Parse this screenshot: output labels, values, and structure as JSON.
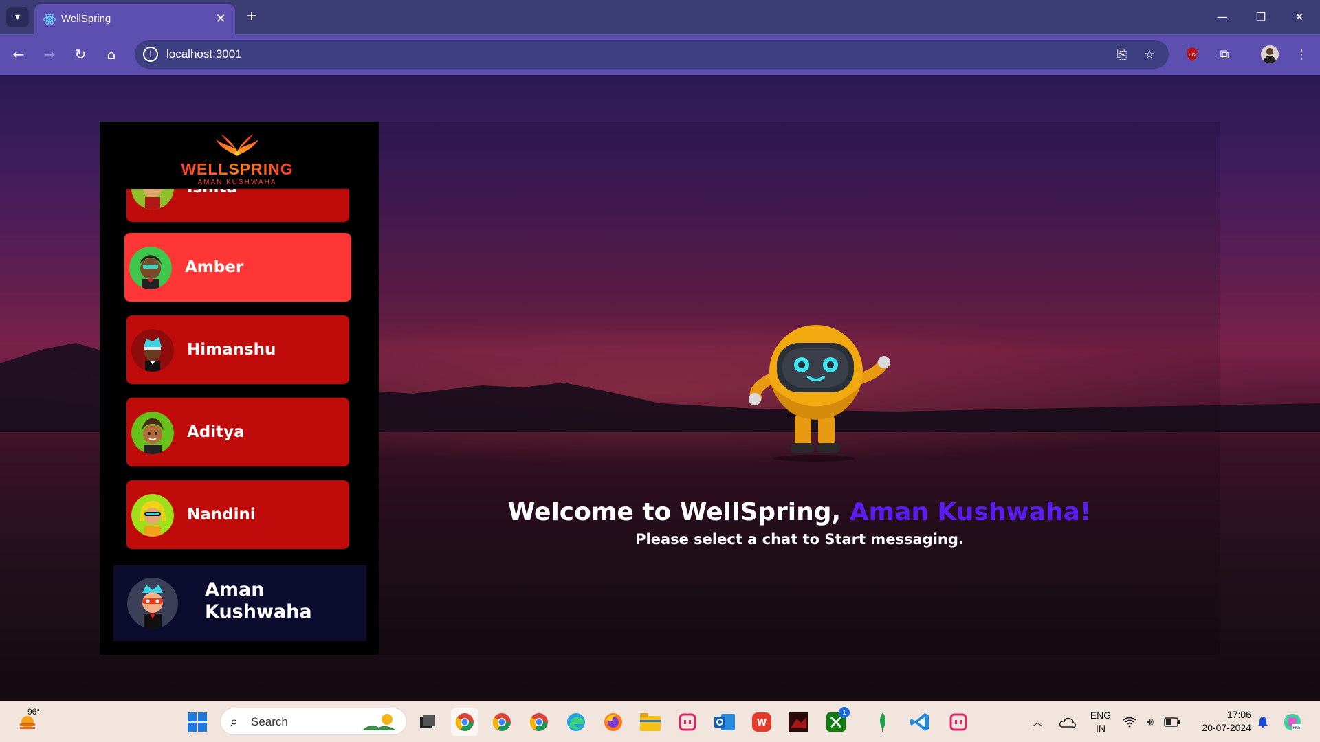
{
  "browser": {
    "tab_title": "WellSpring",
    "url": "localhost:3001"
  },
  "logo": {
    "main": "WELLSPRING",
    "sub": "AMAN KUSHWAHA"
  },
  "contacts": [
    {
      "name": "Ishita"
    },
    {
      "name": "Amber"
    },
    {
      "name": "Himanshu"
    },
    {
      "name": "Aditya"
    },
    {
      "name": "Nandini"
    }
  ],
  "current_user": {
    "name": "Aman Kushwaha"
  },
  "welcome": {
    "prefix": "Welcome to WellSpring, ",
    "user": "Aman Kushwaha!",
    "subtitle": "Please select a chat to Start messaging."
  },
  "taskbar": {
    "weather_temp": "96°",
    "search_placeholder": "Search",
    "lang_line1": "ENG",
    "lang_line2": "IN",
    "time": "17:06",
    "date": "20-07-2024",
    "notification_count": "1"
  },
  "colors": {
    "sidebar_bg": "#000000",
    "contact_bg": "#c00b0b",
    "contact_active_bg": "#ff3636",
    "user_card_bg": "#0c0d2e",
    "highlight_name": "#5a1cf2",
    "chrome_accent": "#5c4fb0"
  }
}
